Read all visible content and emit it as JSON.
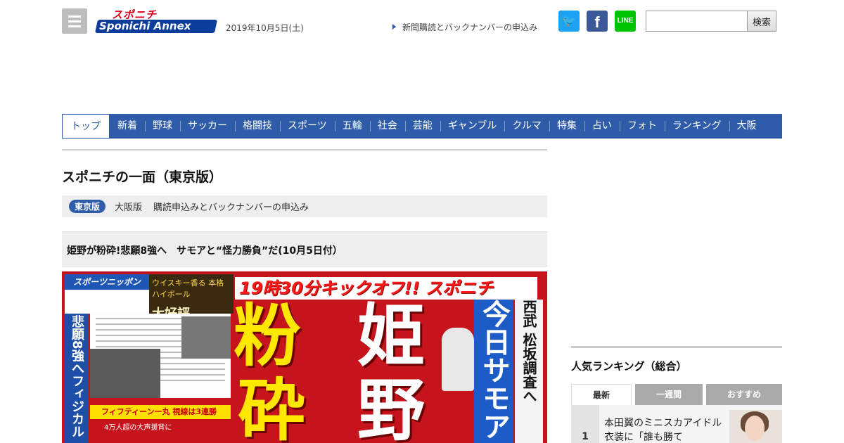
{
  "header": {
    "logo_top": "スポニチ",
    "logo_main": "Sponichi Annex",
    "date": "2019年10月5日(土)",
    "subscribe_link": "新聞購読とバックナンバーの申込み",
    "sns": {
      "twitter": "🐦",
      "facebook": "f",
      "line": "LINE"
    },
    "search": {
      "placeholder": "",
      "button": "検索"
    }
  },
  "nav": {
    "items": [
      "トップ",
      "新着",
      "野球",
      "サッカー",
      "格闘技",
      "スポーツ",
      "五輪",
      "社会",
      "芸能",
      "ギャンブル",
      "クルマ",
      "特集",
      "占い",
      "フォト",
      "ランキング",
      "大阪"
    ],
    "active_index": 0
  },
  "main": {
    "page_title": "スポニチの一面（東京版）",
    "edition": {
      "active": "東京版",
      "other": "大阪版",
      "link": "購読申込みとバックナンバーの申込み"
    },
    "headline": "姫野が粉砕!悲願8強へ　サモアと“怪力勝負”だ(10月5日付）",
    "front_page": {
      "masthead": "スポーツニッポン",
      "ad_text": "ウイスキー香る 本格ハイボール",
      "ad_big": "大好評",
      "banner": "19時30分キックオフ!! スポニチ",
      "side_column": "悲願8強へフィジカル",
      "big_chars": [
        "粉",
        "砕",
        "姫",
        "野"
      ],
      "blue_column": "今日サモア",
      "white_column": "西武 松坂調査へ",
      "caption": "フィフティーン一丸 視線は3連勝",
      "caption2": "4万人超の大声援背に"
    }
  },
  "sidebar": {
    "ranking_title": "人気ランキング（総合）",
    "tabs": [
      "最新",
      "一週間",
      "おすすめ"
    ],
    "items": [
      {
        "rank": "1",
        "text": "本田翼のミニスカアイドル衣装に「誰も勝て"
      }
    ]
  }
}
